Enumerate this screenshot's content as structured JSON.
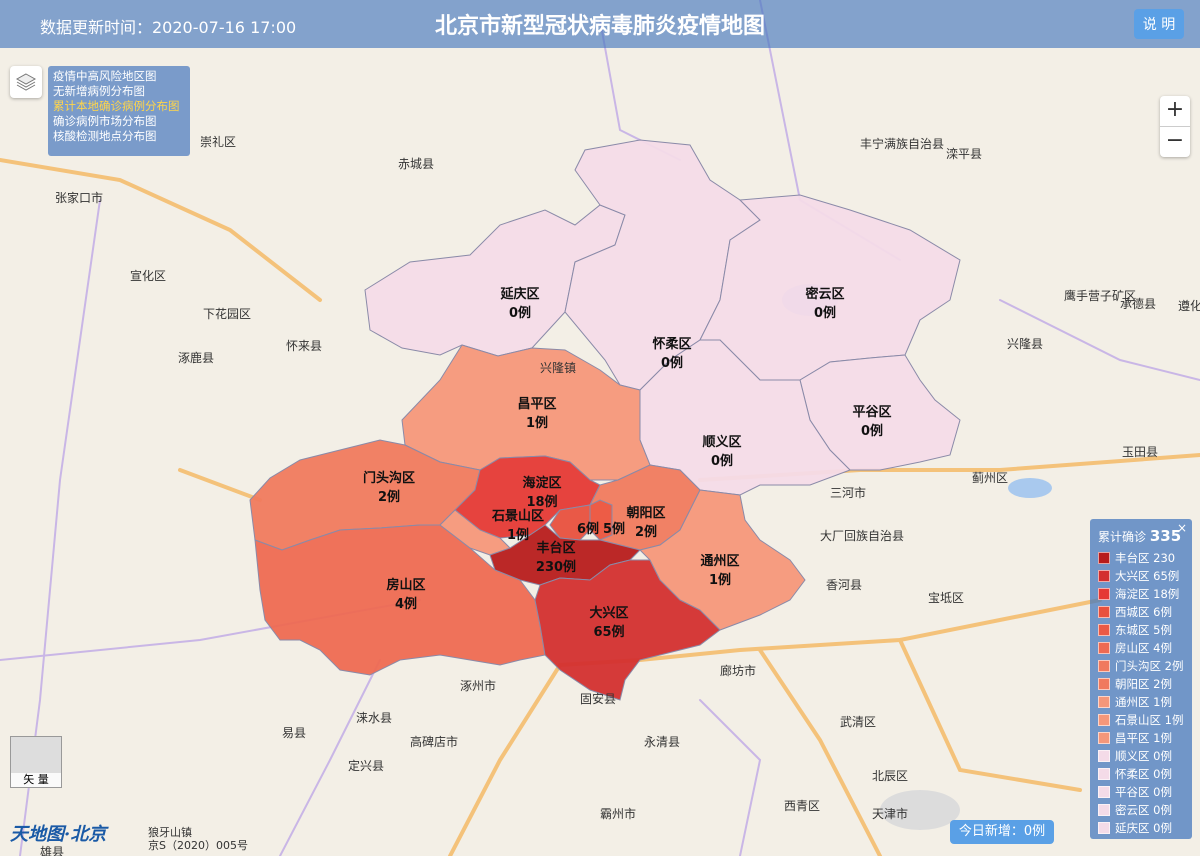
{
  "header": {
    "update_time": "数据更新时间：2020-07-16 17:00",
    "title": "北京市新型冠状病毒肺炎疫情地图",
    "help_label": "说 明"
  },
  "layers": {
    "items": [
      {
        "label": "疫情中高风险地区图",
        "active": false
      },
      {
        "label": "无新增病例分布图",
        "active": false
      },
      {
        "label": "累计本地确诊病例分布图",
        "active": true
      },
      {
        "label": "确诊病例市场分布图",
        "active": false
      },
      {
        "label": "核酸检测地点分布图",
        "active": false
      }
    ]
  },
  "zoom": {
    "in": "+",
    "out": "−"
  },
  "legend": {
    "title": "累计确诊",
    "total": "335",
    "close": "×",
    "items": [
      {
        "label": "丰台区 230",
        "color": "#b71c1c"
      },
      {
        "label": "大兴区 65例",
        "color": "#d32f2f"
      },
      {
        "label": "海淀区 18例",
        "color": "#e53935"
      },
      {
        "label": "西城区 6例",
        "color": "#e8503e"
      },
      {
        "label": "东城区 5例",
        "color": "#ec5a45"
      },
      {
        "label": "房山区 4例",
        "color": "#ee6a52"
      },
      {
        "label": "门头沟区 2例",
        "color": "#f07a5e"
      },
      {
        "label": "朝阳区 2例",
        "color": "#f07a5e"
      },
      {
        "label": "通州区 1例",
        "color": "#f5977a"
      },
      {
        "label": "石景山区 1例",
        "color": "#f5977a"
      },
      {
        "label": "昌平区 1例",
        "color": "#f5977a"
      },
      {
        "label": "顺义区 0例",
        "color": "#f4dbe8"
      },
      {
        "label": "怀柔区 0例",
        "color": "#f4dbe8"
      },
      {
        "label": "平谷区 0例",
        "color": "#f4dbe8"
      },
      {
        "label": "密云区 0例",
        "color": "#f4dbe8"
      },
      {
        "label": "延庆区 0例",
        "color": "#f4dbe8"
      }
    ]
  },
  "districts": [
    {
      "name": "延庆区",
      "count": "0例",
      "color": "#f4dbe8"
    },
    {
      "name": "怀柔区",
      "count": "0例",
      "color": "#f4dbe8"
    },
    {
      "name": "密云区",
      "count": "0例",
      "color": "#f4dbe8"
    },
    {
      "name": "平谷区",
      "count": "0例",
      "color": "#f4dbe8"
    },
    {
      "name": "顺义区",
      "count": "0例",
      "color": "#f4dbe8"
    },
    {
      "name": "昌平区",
      "count": "1例",
      "color": "#f5977a"
    },
    {
      "name": "门头沟区",
      "count": "2例",
      "color": "#f07a5e"
    },
    {
      "name": "房山区",
      "count": "4例",
      "color": "#ee6a52"
    },
    {
      "name": "海淀区",
      "count": "18例",
      "color": "#e53935"
    },
    {
      "name": "石景山区",
      "count": "1例",
      "color": "#f5977a"
    },
    {
      "name": "朝阳区",
      "count": "2例",
      "color": "#f07a5e"
    },
    {
      "name": "丰台区",
      "count": "230例",
      "color": "#b71c1c"
    },
    {
      "name": "大兴区",
      "count": "65例",
      "color": "#d32f2f"
    },
    {
      "name": "通州区",
      "count": "1例",
      "color": "#f5977a"
    }
  ],
  "inner_counts": [
    "6例",
    "5例"
  ],
  "place_labels": [
    "张家口市",
    "宣化区",
    "崇礼区",
    "赤城县",
    "怀来县",
    "涿鹿县",
    "下花园区",
    "丰宁满族自治县",
    "滦平县",
    "兴隆县",
    "承德县",
    "三河市",
    "大厂回族自治县",
    "香河县",
    "廊坊市",
    "固安县",
    "涿州市",
    "涞水县",
    "易县",
    "高碑店市",
    "定兴县",
    "永清县",
    "霸州市",
    "武清区",
    "宝坻区",
    "蓟州区",
    "玉田县",
    "遵化市",
    "天津市",
    "北辰区",
    "西青区",
    "雄县",
    "鹰手营子矿区",
    "兴隆镇"
  ],
  "today": "今日新增：0例",
  "minimap_label": "矢 量",
  "logo": "天地图·北京",
  "copyright": [
    "狼牙山镇",
    "京S（2020）005号"
  ]
}
